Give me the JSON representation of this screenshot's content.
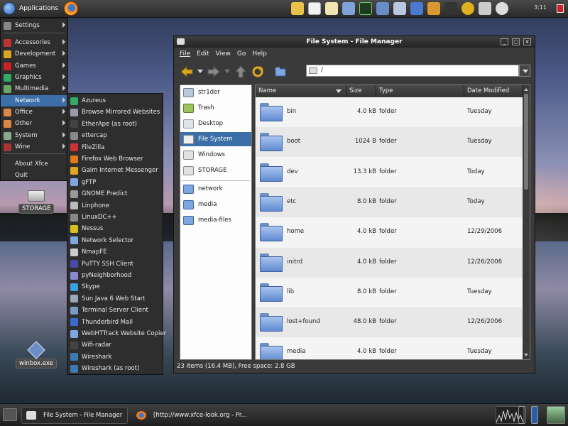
{
  "top_panel": {
    "applications_label": "Applications",
    "clock": "3:11"
  },
  "apps_menu": {
    "items": [
      {
        "label": "Settings",
        "icon": "settings-icon",
        "submenu": true
      },
      {
        "label": "Accessories",
        "icon": "accessories-icon",
        "submenu": true
      },
      {
        "label": "Development",
        "icon": "development-icon",
        "submenu": true
      },
      {
        "label": "Games",
        "icon": "games-icon",
        "submenu": true
      },
      {
        "label": "Graphics",
        "icon": "graphics-icon",
        "submenu": true
      },
      {
        "label": "Multimedia",
        "icon": "multimedia-icon",
        "submenu": true
      },
      {
        "label": "Network",
        "icon": "network-icon",
        "submenu": true,
        "active": true
      },
      {
        "label": "Office",
        "icon": "office-icon",
        "submenu": true
      },
      {
        "label": "Other",
        "icon": "other-icon",
        "submenu": true
      },
      {
        "label": "System",
        "icon": "system-icon",
        "submenu": true
      },
      {
        "label": "Wine",
        "icon": "wine-icon",
        "submenu": true
      },
      {
        "label": "About Xfce",
        "icon": "",
        "submenu": false
      },
      {
        "label": "Quit",
        "icon": "",
        "submenu": false
      }
    ]
  },
  "network_menu": {
    "items": [
      "Azureus",
      "Browse Mirrored Websites",
      "EtherApe (as root)",
      "ettercap",
      "FileZilla",
      "Firefox Web Browser",
      "Gaim Internet Messenger",
      "gFTP",
      "GNOME Predict",
      "Linphone",
      "LinuxDC++",
      "Nessus",
      "Network Selector",
      "NmapFE",
      "PuTTY SSH Client",
      "pyNeighborhood",
      "Skype",
      "Sun Java 6 Web Start",
      "Terminal Server Client",
      "Thunderbird Mail",
      "WebHTTrack Website Copier",
      "Wifi-radar",
      "Wireshark",
      "Wireshark (as root)"
    ]
  },
  "desktop": {
    "storage_label": "STORAGE",
    "winbox_label": "winbox.exe"
  },
  "file_manager": {
    "title": "File System - File Manager",
    "menu": [
      "File",
      "Edit",
      "View",
      "Go",
      "Help"
    ],
    "location": "/",
    "sidebar": {
      "places": [
        "str1der",
        "Trash",
        "Desktop",
        "File System",
        "Windows",
        "STORAGE"
      ],
      "bookmarks": [
        "network",
        "media",
        "media-files"
      ],
      "selected": "File System"
    },
    "columns": [
      "Name",
      "Size",
      "Type",
      "Date Modified"
    ],
    "files": [
      {
        "name": "bin",
        "size": "4.0 kB",
        "type": "folder",
        "date": "Tuesday"
      },
      {
        "name": "boot",
        "size": "1024 B",
        "type": "folder",
        "date": "Tuesday"
      },
      {
        "name": "dev",
        "size": "13.3 kB",
        "type": "folder",
        "date": "Today"
      },
      {
        "name": "etc",
        "size": "8.0 kB",
        "type": "folder",
        "date": "Today"
      },
      {
        "name": "home",
        "size": "4.0 kB",
        "type": "folder",
        "date": "12/29/2006"
      },
      {
        "name": "initrd",
        "size": "4.0 kB",
        "type": "folder",
        "date": "12/26/2006"
      },
      {
        "name": "lib",
        "size": "8.0 kB",
        "type": "folder",
        "date": "Tuesday"
      },
      {
        "name": "lost+found",
        "size": "48.0 kB",
        "type": "folder",
        "date": "12/26/2006"
      },
      {
        "name": "media",
        "size": "4.0 kB",
        "type": "folder",
        "date": "Tuesday"
      }
    ],
    "status": "23 items (16.4 MB), Free space: 2.8 GB"
  },
  "taskbar": {
    "tasks": [
      {
        "label": "File System - File Manager",
        "active": true
      },
      {
        "label": "[http://www.xfce-look.org - Pr...",
        "active": false
      }
    ]
  }
}
